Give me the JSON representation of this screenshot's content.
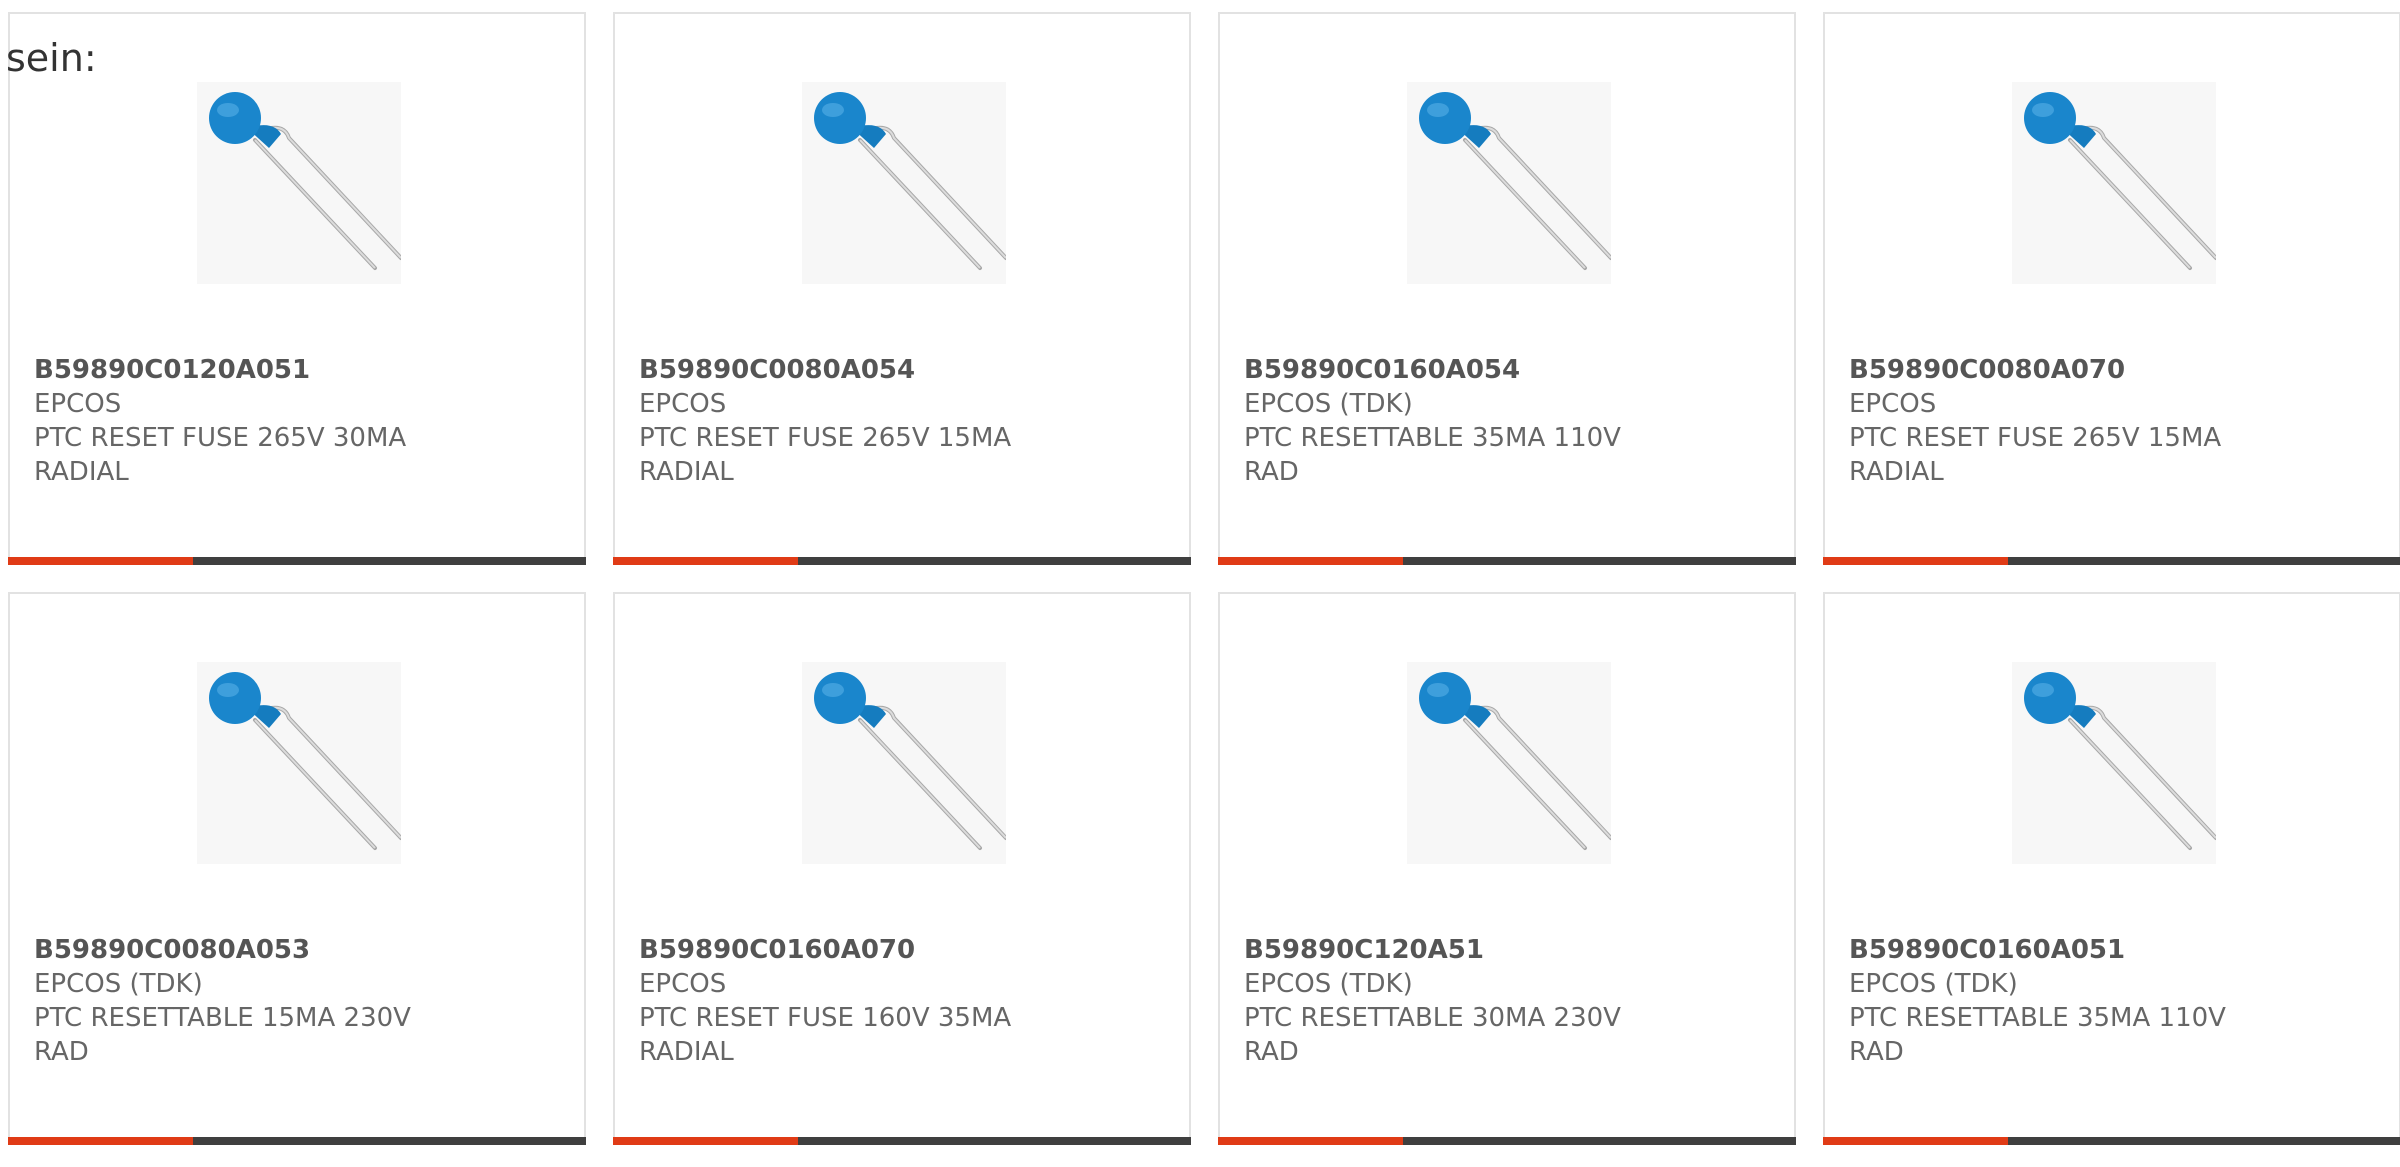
{
  "intro_text": "sein:",
  "colors": {
    "accent": "#e03b16",
    "bar_dark": "#3f3f3f",
    "component_blue": "#1a86cc"
  },
  "products": [
    {
      "part_number": "B59890C0120A051",
      "manufacturer": "EPCOS",
      "description": "PTC RESET FUSE 265V 30MA\nRADIAL",
      "image_icon": "ptc-thermistor-image"
    },
    {
      "part_number": "B59890C0080A054",
      "manufacturer": "EPCOS",
      "description": "PTC RESET FUSE 265V 15MA\nRADIAL",
      "image_icon": "ptc-thermistor-image"
    },
    {
      "part_number": "B59890C0160A054",
      "manufacturer": "EPCOS (TDK)",
      "description": "PTC RESETTABLE 35MA 110V\nRAD",
      "image_icon": "ptc-thermistor-image"
    },
    {
      "part_number": "B59890C0080A070",
      "manufacturer": "EPCOS",
      "description": "PTC RESET FUSE 265V 15MA\nRADIAL",
      "image_icon": "ptc-thermistor-image"
    },
    {
      "part_number": "B59890C0080A053",
      "manufacturer": "EPCOS (TDK)",
      "description": "PTC RESETTABLE 15MA 230V\nRAD",
      "image_icon": "ptc-thermistor-image"
    },
    {
      "part_number": "B59890C0160A070",
      "manufacturer": "EPCOS",
      "description": "PTC RESET FUSE 160V 35MA\nRADIAL",
      "image_icon": "ptc-thermistor-image"
    },
    {
      "part_number": "B59890C120A51",
      "manufacturer": "EPCOS (TDK)",
      "description": "PTC RESETTABLE 30MA 230V\nRAD",
      "image_icon": "ptc-thermistor-image"
    },
    {
      "part_number": "B59890C0160A051",
      "manufacturer": "EPCOS (TDK)",
      "description": "PTC RESETTABLE 35MA 110V\nRAD",
      "image_icon": "ptc-thermistor-image"
    }
  ]
}
